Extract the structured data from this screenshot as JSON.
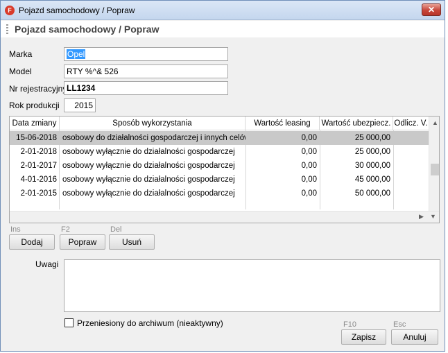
{
  "window": {
    "title": "Pojazd samochodowy / Popraw",
    "app_icon_letter": "F",
    "close_glyph": "✕"
  },
  "header": {
    "title": "Pojazd samochodowy / Popraw"
  },
  "form": {
    "marka_label": "Marka",
    "marka_value": "Opel",
    "model_label": "Model",
    "model_value": "RTY %^& 526",
    "nr_label": "Nr rejestracyjny",
    "nr_value": "LL1234",
    "rok_label": "Rok produkcji",
    "rok_value": "2015"
  },
  "table": {
    "columns": [
      "Data zmiany",
      "Sposób wykorzystania",
      "Wartość leasing",
      "Wartość ubezpiecz.",
      "Odlicz. V."
    ],
    "rows": [
      {
        "date": "15-06-2018",
        "usage": "osobowy do działalności gospodarczej i innych celów",
        "leasing": "0,00",
        "insurance": "25 000,00"
      },
      {
        "date": "2-01-2018",
        "usage": "osobowy wyłącznie do działalności gospodarczej",
        "leasing": "0,00",
        "insurance": "25 000,00"
      },
      {
        "date": "2-01-2017",
        "usage": "osobowy wyłącznie do działalności gospodarczej",
        "leasing": "0,00",
        "insurance": "30 000,00"
      },
      {
        "date": "4-01-2016",
        "usage": "osobowy wyłącznie do działalności gospodarczej",
        "leasing": "0,00",
        "insurance": "45 000,00"
      },
      {
        "date": "2-01-2015",
        "usage": "osobowy wyłącznie do działalności gospodarczej",
        "leasing": "0,00",
        "insurance": "50 000,00"
      }
    ],
    "selected_row": 0
  },
  "actions": {
    "add": {
      "hotkey": "Ins",
      "label": "Dodaj"
    },
    "edit": {
      "hotkey": "F2",
      "label": "Popraw"
    },
    "delete": {
      "hotkey": "Del",
      "label": "Usuń"
    }
  },
  "notes": {
    "label": "Uwagi",
    "value": ""
  },
  "archive": {
    "label": "Przeniesiony do archiwum (nieaktywny)",
    "checked": false
  },
  "footer": {
    "save": {
      "hotkey": "F10",
      "label": "Zapisz"
    },
    "cancel": {
      "hotkey": "Esc",
      "label": "Anuluj"
    }
  },
  "icons": {
    "scroll_up": "scroll-up-icon",
    "scroll_down": "scroll-down-icon",
    "scroll_left": "scroll-left-icon",
    "scroll_right": "scroll-right-icon"
  }
}
